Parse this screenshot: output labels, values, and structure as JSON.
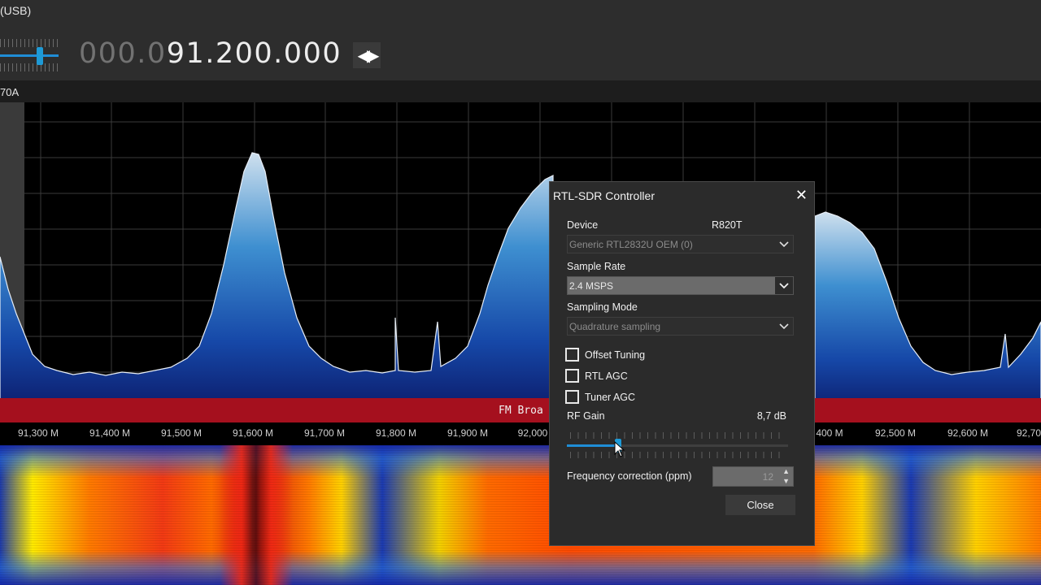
{
  "header": {
    "mode_label": "(USB)",
    "freq_dim": "000.0",
    "freq_bright": "91.200.000"
  },
  "subbar": {
    "label": "70A"
  },
  "band_label": "FM Broa",
  "axis_ticks": [
    "91,300 M",
    "91,400 M",
    "91,500 M",
    "91,600 M",
    "91,700 M",
    "91,800 M",
    "91,900 M",
    "92,000",
    "400 M",
    "92,500 M",
    "92,600 M",
    "92,70"
  ],
  "dialog": {
    "title": "RTL-SDR Controller",
    "device_label": "Device",
    "device_tuner": "R820T",
    "device_value": "Generic RTL2832U OEM (0)",
    "sample_rate_label": "Sample Rate",
    "sample_rate_value": "2.4 MSPS",
    "sampling_mode_label": "Sampling Mode",
    "sampling_mode_value": "Quadrature sampling",
    "offset_tuning_label": "Offset Tuning",
    "rtl_agc_label": "RTL AGC",
    "tuner_agc_label": "Tuner AGC",
    "rf_gain_label": "RF Gain",
    "rf_gain_value": "8,7 dB",
    "freq_corr_label": "Frequency correction (ppm)",
    "freq_corr_value": "12",
    "close_label": "Close",
    "offset_tuning_checked": false,
    "rtl_agc_checked": false,
    "tuner_agc_checked": false,
    "rf_gain_fraction": 0.23
  },
  "colors": {
    "accent": "#1e9ad6",
    "band_bar": "#a5101e",
    "spectrum_fill_top": "#b8d4ea",
    "spectrum_fill_bottom": "#0a1f8a"
  }
}
